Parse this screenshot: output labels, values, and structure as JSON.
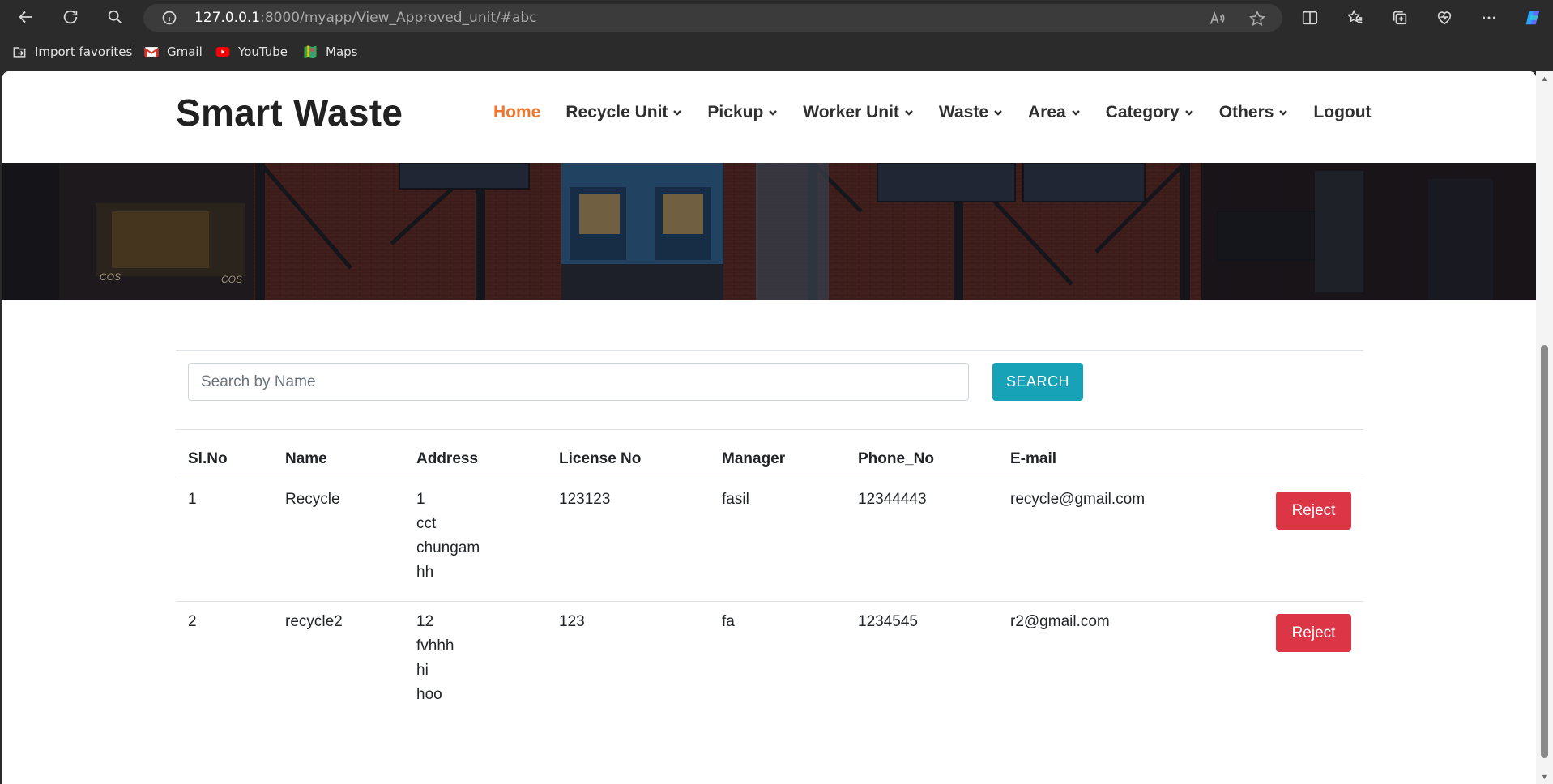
{
  "browser": {
    "url_host": "127.0.0.1",
    "url_path": ":8000/myapp/View_Approved_unit/#abc",
    "favorites": [
      {
        "label": "Import favorites",
        "icon": "import-icon"
      },
      {
        "label": "Gmail",
        "icon": "gmail-icon"
      },
      {
        "label": "YouTube",
        "icon": "youtube-icon"
      },
      {
        "label": "Maps",
        "icon": "maps-icon"
      }
    ]
  },
  "site": {
    "brand": "Smart Waste",
    "menu": [
      {
        "label": "Home",
        "active": true,
        "dropdown": false
      },
      {
        "label": "Recycle Unit",
        "active": false,
        "dropdown": true
      },
      {
        "label": "Pickup",
        "active": false,
        "dropdown": true
      },
      {
        "label": "Worker Unit",
        "active": false,
        "dropdown": true
      },
      {
        "label": "Waste",
        "active": false,
        "dropdown": true
      },
      {
        "label": "Area",
        "active": false,
        "dropdown": true
      },
      {
        "label": "Category",
        "active": false,
        "dropdown": true
      },
      {
        "label": "Others",
        "active": false,
        "dropdown": true
      },
      {
        "label": "Logout",
        "active": false,
        "dropdown": false
      }
    ],
    "accent_color": "#f0762b"
  },
  "search": {
    "placeholder": "Search by Name",
    "value": "",
    "button_label": "SEARCH"
  },
  "table": {
    "headers": [
      "Sl.No",
      "Name",
      "Address",
      "License No",
      "Manager",
      "Phone_No",
      "E-mail"
    ],
    "rows": [
      {
        "sl_no": "1",
        "name": "Recycle",
        "address": [
          "1",
          "cct",
          "chungam",
          "hh"
        ],
        "license_no": "123123",
        "manager": "fasil",
        "phone": "12344443",
        "email": "recycle@gmail.com",
        "action": "Reject"
      },
      {
        "sl_no": "2",
        "name": "recycle2",
        "address": [
          "12",
          "fvhhh",
          "hi",
          "hoo"
        ],
        "license_no": "123",
        "manager": "fa",
        "phone": "1234545",
        "email": "r2@gmail.com",
        "action": "Reject"
      }
    ]
  }
}
